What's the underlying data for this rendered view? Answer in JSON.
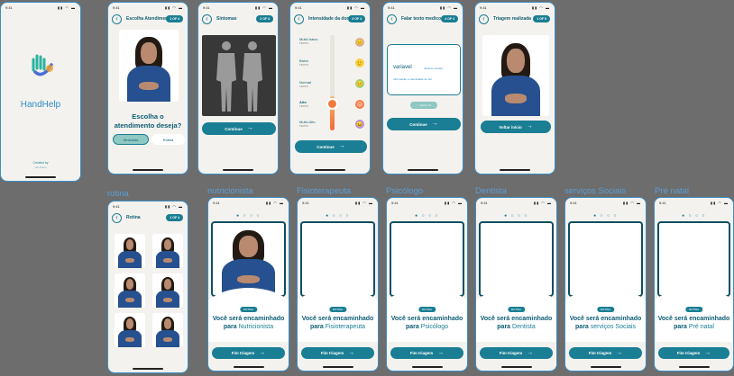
{
  "status": {
    "time": "9:41",
    "icons": "▮▮ ◠ ▬"
  },
  "splash": {
    "app_name": "HandHelp",
    "credit_line1": "Created by",
    "credit_line2": "HandHelp"
  },
  "s_atendimento": {
    "title": "Escolha Atendimento",
    "step": "1 OF 4",
    "question": "Escolha o atendimento deseja?",
    "option_sintomas": "Sintomas",
    "option_rotina": "Rotina"
  },
  "s_sintomas": {
    "title": "Sintomas",
    "step": "2 OF 4",
    "continue": "Continue"
  },
  "s_dor": {
    "title": "Intensidade da dor",
    "step": "3 OF 4",
    "continue": "Continue",
    "levels": [
      {
        "label": "Muito baixo",
        "sub": "TEXTO",
        "face": "😐"
      },
      {
        "label": "Baixo",
        "sub": "TEXTO",
        "face": "🙂"
      },
      {
        "label": "Normal",
        "sub": "TEXTO",
        "face": "😐"
      },
      {
        "label": "Alto",
        "sub": "TEXTO",
        "face": "☹"
      },
      {
        "label": "Muito Alto",
        "sub": "TEXTO",
        "face": "😖"
      }
    ],
    "selected_index": 3
  },
  "s_falar": {
    "title": "Falar texto medico",
    "step": "4 OF 4",
    "word": "variavel",
    "word_hint": "Variável extraída",
    "sentence": "Informação e intensidade de dor",
    "play": "Ouvir voz",
    "continue": "Continue"
  },
  "s_triagem": {
    "title": "Triagem realizada",
    "step": "1 OF 5",
    "button": "Voltar início"
  },
  "labels": {
    "rotina": "rotina",
    "nutricionista": "nutricionista",
    "fisioterapeuta": "Fisioterapeuta",
    "psicologo": "Psicólogo",
    "dentista": "Dentista",
    "servicos": "serviços Sociais",
    "prenatal": "Pré natal"
  },
  "s_rotina": {
    "title": "Rotina",
    "step": "1 OF 4"
  },
  "result": {
    "dots": "● ○ ○ ○",
    "pill": "ROTINA",
    "line1": "Você será encaminhado",
    "para": "para",
    "button": "Fim triagem"
  },
  "destinations": [
    "Nutricionista",
    "Fisioterapeuta",
    "Psicólogo",
    "Dentista",
    "serviços Sociais",
    "Pré natal"
  ],
  "colors": {
    "accent": "#1a7e94",
    "dark": "#0d5d74",
    "border": "#3a8fc9",
    "bg": "#6d6d6d"
  }
}
